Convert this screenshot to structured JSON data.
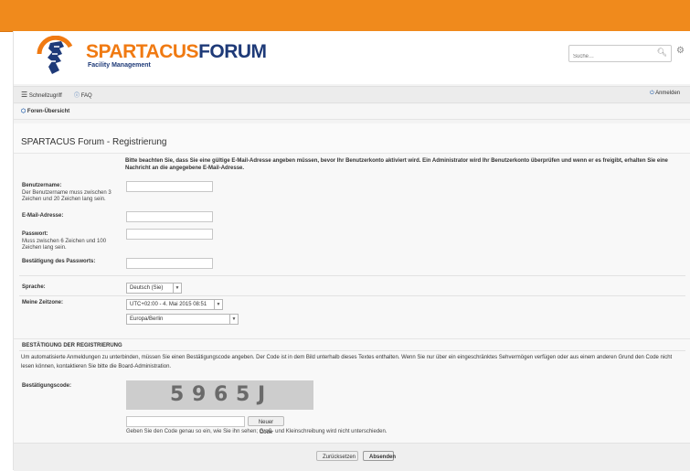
{
  "header": {
    "brand_primary": "SPARTACUS",
    "brand_secondary": "FORUM",
    "tagline": "Facility Management",
    "search_placeholder": "Suche…"
  },
  "nav": {
    "quicklinks": "Schnellzugriff",
    "faq": "FAQ",
    "login": "Anmelden"
  },
  "breadcrumb": {
    "home": "Foren-Übersicht"
  },
  "page": {
    "title": "SPARTACUS Forum - Registrierung"
  },
  "form": {
    "notice": "Bitte beachten Sie, dass Sie eine gültige E-Mail-Adresse angeben müssen, bevor Ihr Benutzerkonto aktiviert wird. Ein Administrator wird Ihr Benutzerkonto überprüfen und wenn er es freigibt, erhalten Sie eine Nachricht an die angegebene E-Mail-Adresse.",
    "username_label": "Benutzername:",
    "username_hint": "Der Benutzername muss zwischen 3 Zeichen und 20 Zeichen lang sein.",
    "email_label": "E-Mail-Adresse:",
    "password_label": "Passwort:",
    "password_hint": "Muss zwischen 6 Zeichen und 100 Zeichen lang sein.",
    "confirm_label": "Bestätigung des Passworts:",
    "language_label": "Sprache:",
    "language_value": "Deutsch (Sie)",
    "timezone_label": "Meine Zeitzone:",
    "timezone_value": "UTC+02:00 - 4. Mai 2015 08:51",
    "region_value": "Europa/Berlin"
  },
  "captcha": {
    "section_title": "BESTÄTIGUNG DER REGISTRIERUNG",
    "description": "Um automatisierte Anmeldungen zu unterbinden, müssen Sie einen Bestätigungscode angeben. Der Code ist in dem Bild unterhalb dieses Textes enthalten. Wenn Sie nur über ein eingeschränktes Sehvermögen verfügen oder aus einem anderen Grund den Code nicht lesen können, kontaktieren Sie bitte die Board-Administration.",
    "code_label": "Bestätigungscode:",
    "code_chars": [
      "5",
      "9",
      "6",
      "5",
      "J"
    ],
    "new_code_button": "Neuer Code",
    "instruction": "Geben Sie den Code genau so ein, wie Sie ihn sehen; Groß- und Kleinschreibung wird nicht unterschieden."
  },
  "actions": {
    "reset": "Zurücksetzen",
    "submit": "Absenden"
  },
  "colors": {
    "topbar": "#f08a1c",
    "brand_orange": "#f07a12",
    "brand_blue": "#1e3a78",
    "link_blue": "#1e5aa8"
  }
}
